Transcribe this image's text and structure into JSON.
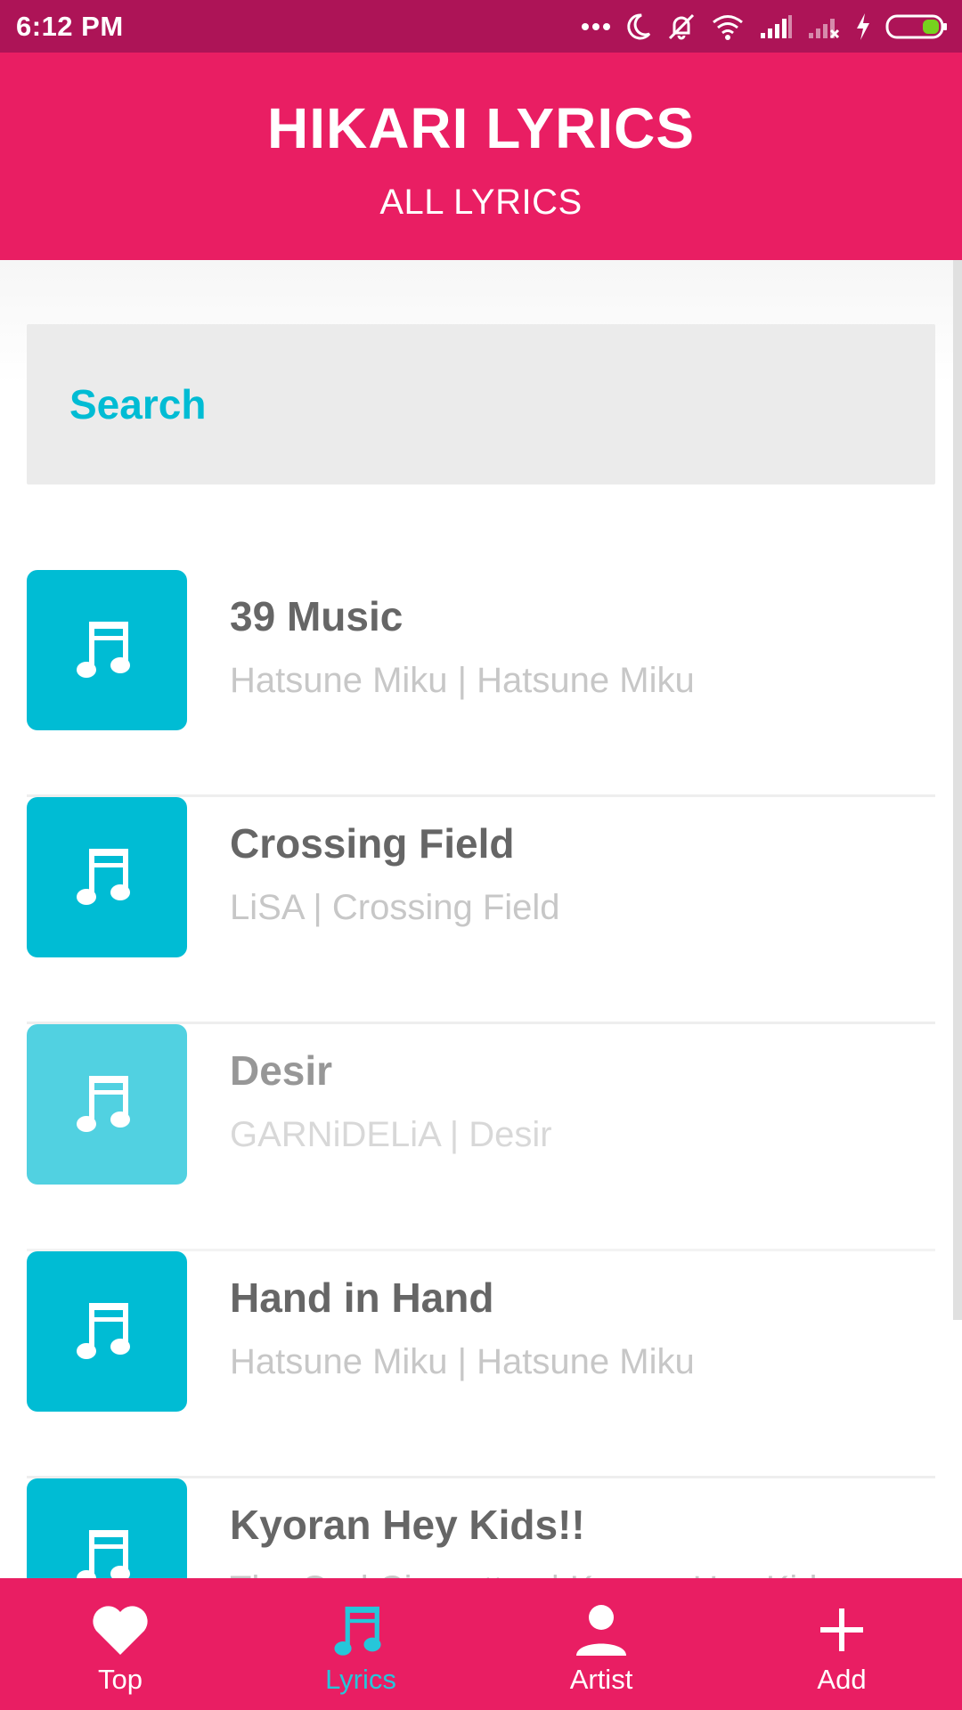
{
  "status_bar": {
    "time": "6:12 PM"
  },
  "header": {
    "title": "HIKARI LYRICS",
    "subtitle": "ALL LYRICS"
  },
  "search": {
    "label": "Search"
  },
  "songs": [
    {
      "title": "39 Music",
      "subtitle": "Hatsune Miku | Hatsune Miku"
    },
    {
      "title": "Crossing Field",
      "subtitle": "LiSA | Crossing Field"
    },
    {
      "title": "Desir",
      "subtitle": "GARNiDELiA | Desir"
    },
    {
      "title": "Hand in Hand",
      "subtitle": "Hatsune Miku | Hatsune Miku"
    },
    {
      "title": "Kyoran Hey Kids!!",
      "subtitle": "The Oral Cigarettes | Kyoran Hey Kids"
    }
  ],
  "nav": [
    {
      "label": "Top",
      "icon": "heart-icon"
    },
    {
      "label": "Lyrics",
      "icon": "music-note-icon",
      "active": true
    },
    {
      "label": "Artist",
      "icon": "person-icon"
    },
    {
      "label": "Add",
      "icon": "plus-icon"
    }
  ],
  "colors": {
    "status_bar": "#ad1457",
    "primary": "#e91e63",
    "accent": "#00bcd4",
    "active_nav": "#26c6da",
    "battery": "#76d31e"
  }
}
